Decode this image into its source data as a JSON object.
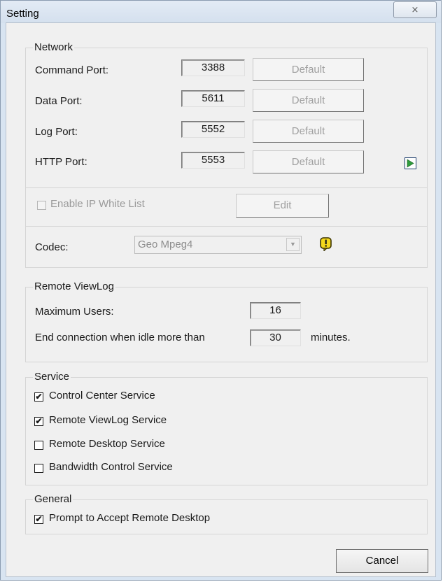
{
  "window": {
    "title": "Setting",
    "close_glyph": "⨯"
  },
  "network": {
    "title": "Network",
    "ports": [
      {
        "label": "Command Port:",
        "value": "3388",
        "button": "Default"
      },
      {
        "label": "Data Port:",
        "value": "5611",
        "button": "Default"
      },
      {
        "label": "Log Port:",
        "value": "5552",
        "button": "Default"
      },
      {
        "label": "HTTP Port:",
        "value": "5553",
        "button": "Default"
      }
    ],
    "more_icon": "play-arrow-icon",
    "ip_white_list": {
      "label": "Enable IP White List",
      "checked": false,
      "button": "Edit"
    },
    "codec": {
      "label": "Codec:",
      "value": "Geo Mpeg4",
      "warning_icon": "exclamation-icon"
    }
  },
  "remote_viewlog": {
    "title": "Remote ViewLog",
    "max_users_label": "Maximum Users:",
    "max_users_value": "16",
    "idle_label": "End connection when idle more than",
    "idle_value": "30",
    "idle_unit": "minutes."
  },
  "service": {
    "title": "Service",
    "items": [
      {
        "label": "Control Center Service",
        "checked": true
      },
      {
        "label": "Remote ViewLog Service",
        "checked": true
      },
      {
        "label": "Remote Desktop Service",
        "checked": false
      },
      {
        "label": "Bandwidth Control Service",
        "checked": false
      }
    ]
  },
  "general": {
    "title": "General",
    "items": [
      {
        "label": "Prompt to Accept Remote Desktop",
        "checked": true
      }
    ]
  },
  "footer": {
    "cancel_label": "Cancel"
  },
  "check_glyph": "✔",
  "colors": {
    "icon_green": "#2e9c3c",
    "icon_yellow": "#f4d81c",
    "frame": "#d8e4f1"
  }
}
